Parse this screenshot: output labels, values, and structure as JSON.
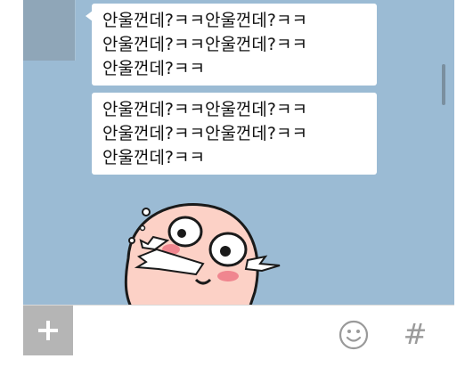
{
  "chat": {
    "messages": [
      {
        "text": "안울껀데?ㅋㅋ안울껀데?ㅋㅋ\n안울껀데?ㅋㅋ안울껀데?ㅋㅋ\n안울껀데?ㅋㅋ"
      },
      {
        "text": "안울껀데?ㅋㅋ안울껀데?ㅋㅋ\n안울껀데?ㅋㅋ안울껀데?ㅋㅋ\n안울껀데?ㅋㅋ"
      }
    ],
    "sticker": {
      "icon": "crying-peach-sticker-icon"
    }
  },
  "input_bar": {
    "plus_icon": "plus-icon",
    "emoji_icon": "smiley-icon",
    "hash_label": "#"
  },
  "colors": {
    "chat_background": "#9bbbd4",
    "bubble": "#ffffff",
    "plus_button_bg": "#b5b5b5",
    "icon_gray": "#9a9a9a",
    "peach": "#fcd1c6",
    "blush": "#f0868f"
  }
}
